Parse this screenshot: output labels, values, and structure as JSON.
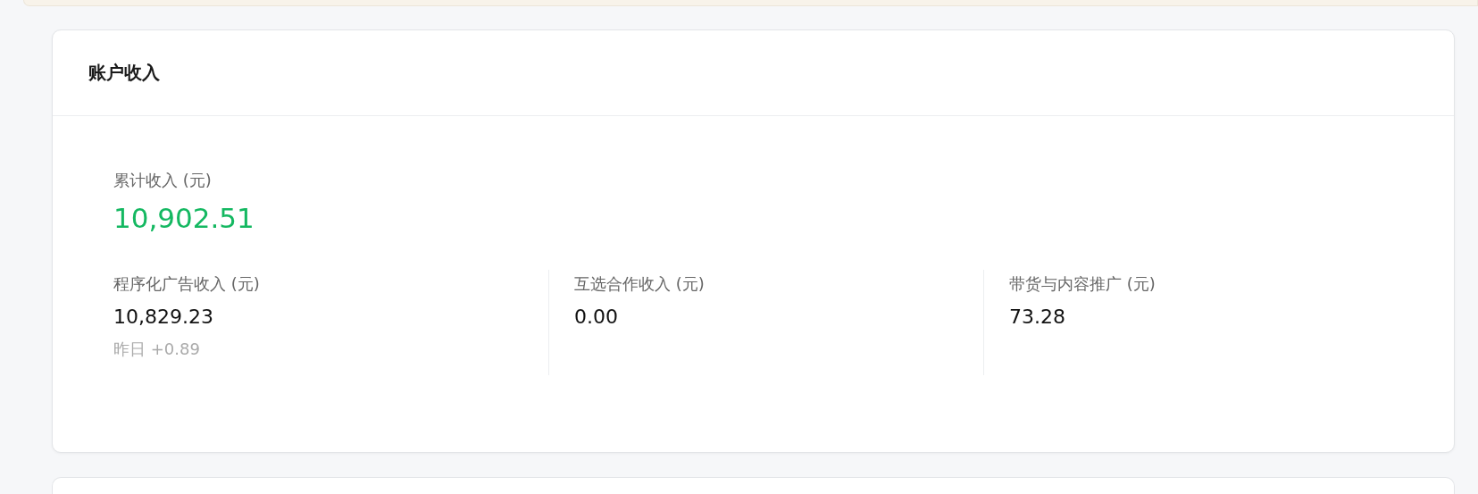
{
  "card": {
    "title": "账户收入"
  },
  "total": {
    "label": "累计收入 (元)",
    "value": "10,902.51"
  },
  "breakdown": [
    {
      "label": "程序化广告收入 (元)",
      "value": "10,829.23",
      "yesterday": "昨日 +0.89"
    },
    {
      "label": "互选合作收入 (元)",
      "value": "0.00"
    },
    {
      "label": "带货与内容推广 (元)",
      "value": "73.28"
    }
  ]
}
